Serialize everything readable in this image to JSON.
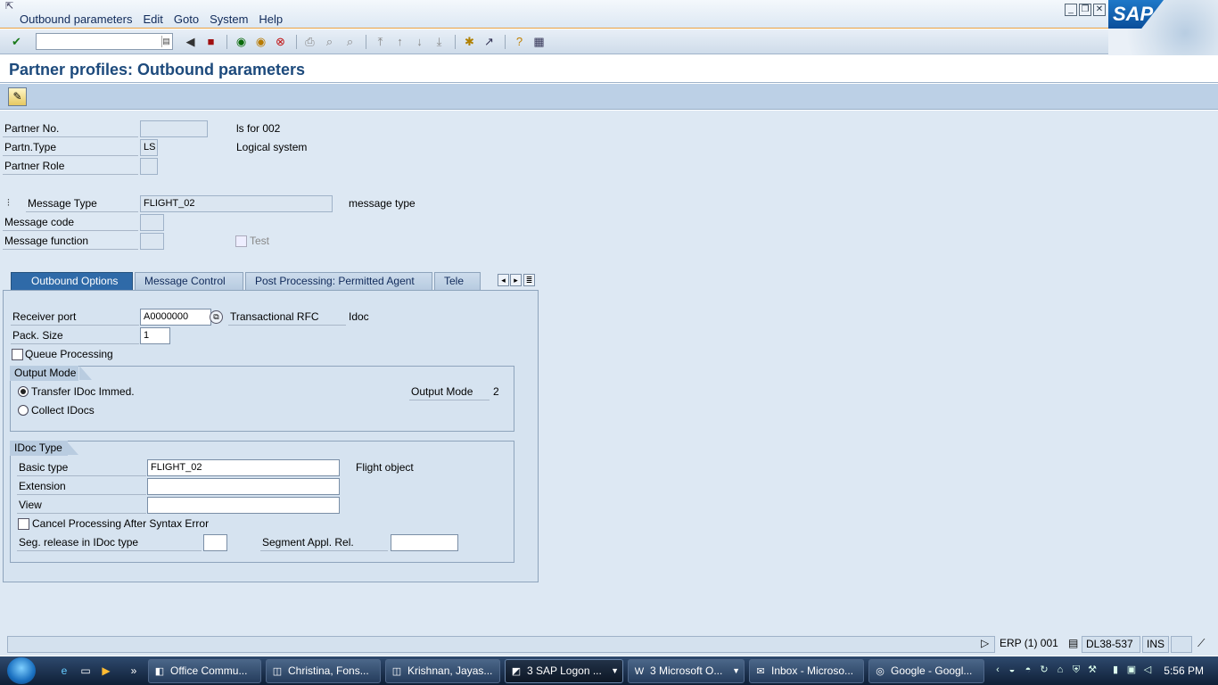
{
  "menu": {
    "items": [
      "Outbound parameters",
      "Edit",
      "Goto",
      "System",
      "Help"
    ]
  },
  "window_buttons": {
    "minimize": "_",
    "restore": "❐",
    "close": "✕"
  },
  "logo": "SAP",
  "title": "Partner profiles: Outbound parameters",
  "header": {
    "partner_no_label": "Partner No.",
    "partner_no_value": "",
    "partner_no_text": "ls for 002",
    "partn_type_label": "Partn.Type",
    "partn_type_value": "LS",
    "partn_type_text": "Logical system",
    "partner_role_label": "Partner Role",
    "partner_role_value": "",
    "message_type_label": "Message Type",
    "message_type_value": "FLIGHT_02",
    "message_type_text": "message type",
    "message_code_label": "Message code",
    "message_function_label": "Message function",
    "test_label": "Test"
  },
  "tabs": [
    "Outbound Options",
    "Message Control",
    "Post Processing: Permitted Agent",
    "Tele"
  ],
  "outbound": {
    "receiver_port_label": "Receiver port",
    "receiver_port_value": "A0000000",
    "port_type": "Transactional RFC",
    "port_type_suffix": "Idoc",
    "pack_size_label": "Pack. Size",
    "pack_size_value": "1",
    "queue_processing_label": "Queue Processing",
    "output_mode_title": "Output Mode",
    "transfer_immed_label": "Transfer IDoc Immed.",
    "collect_idocs_label": "Collect IDocs",
    "output_mode_label": "Output Mode",
    "output_mode_value": "2",
    "idoc_type_title": "IDoc Type",
    "basic_type_label": "Basic type",
    "basic_type_value": "FLIGHT_02",
    "basic_type_text": "Flight object",
    "extension_label": "Extension",
    "view_label": "View",
    "cancel_processing_label": "Cancel Processing After Syntax Error",
    "seg_release_label": "Seg. release in IDoc type",
    "segment_appl_label": "Segment Appl. Rel."
  },
  "status": {
    "system": "ERP (1) 001",
    "server": "DL38-537",
    "mode": "INS"
  },
  "taskbar": {
    "tasks": [
      "Office Commu...",
      "Christina, Fons...",
      "Krishnan, Jayas...",
      "3 SAP Logon ...",
      "3 Microsoft O...",
      "Inbox - Microso...",
      "Google - Googl..."
    ],
    "clock": "5:56 PM"
  }
}
